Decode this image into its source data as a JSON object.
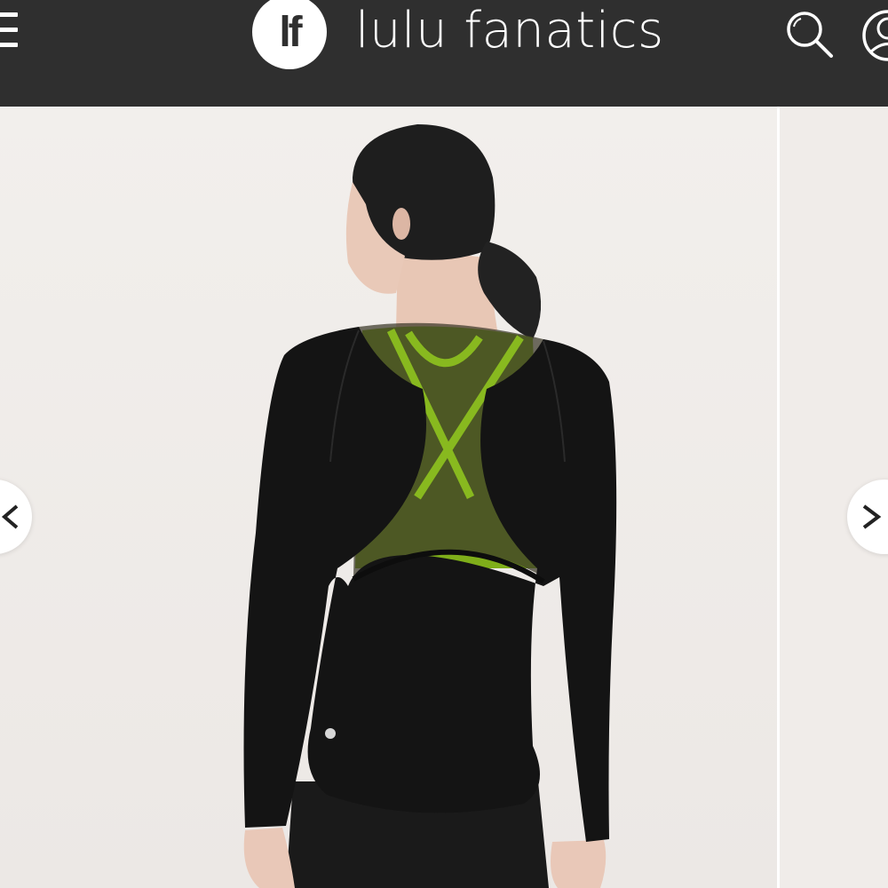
{
  "header": {
    "logo_letters": "lf",
    "brand_name": "lulu fanatics",
    "background": "#2f2f2f",
    "icons": [
      "menu-icon",
      "search-icon",
      "account-icon"
    ]
  },
  "gallery": {
    "image_subject": "product-photo",
    "prev_icon": "chevron-left-icon",
    "next_icon": "chevron-right-icon"
  },
  "colors": {
    "shirt": "#141414",
    "sports_bra": "#7fae1a",
    "mesh": "#3a3828",
    "background": "#efebe8"
  }
}
